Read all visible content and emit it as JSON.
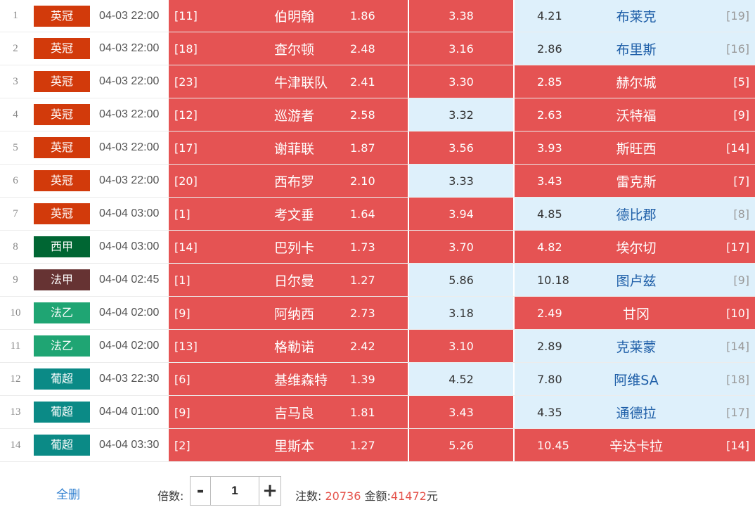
{
  "matches": [
    {
      "idx": "1",
      "league": "英冠",
      "league_color": "#d23a0b",
      "time": "04-03 22:00",
      "home_rank": "[11]",
      "home": "伯明翰",
      "home_odds": "1.86",
      "draw_odds": "3.38",
      "away_odds": "4.21",
      "away": "布莱克",
      "away_rank": "[19]",
      "home_sel": true,
      "draw_sel": true,
      "away_sel": false
    },
    {
      "idx": "2",
      "league": "英冠",
      "league_color": "#d23a0b",
      "time": "04-03 22:00",
      "home_rank": "[18]",
      "home": "查尔顿",
      "home_odds": "2.48",
      "draw_odds": "3.16",
      "away_odds": "2.86",
      "away": "布里斯",
      "away_rank": "[16]",
      "home_sel": true,
      "draw_sel": true,
      "away_sel": false
    },
    {
      "idx": "3",
      "league": "英冠",
      "league_color": "#d23a0b",
      "time": "04-03 22:00",
      "home_rank": "[23]",
      "home": "牛津联队",
      "home_odds": "2.41",
      "draw_odds": "3.30",
      "away_odds": "2.85",
      "away": "赫尔城",
      "away_rank": "[5]",
      "home_sel": true,
      "draw_sel": true,
      "away_sel": true
    },
    {
      "idx": "4",
      "league": "英冠",
      "league_color": "#d23a0b",
      "time": "04-03 22:00",
      "home_rank": "[12]",
      "home": "巡游者",
      "home_odds": "2.58",
      "draw_odds": "3.32",
      "away_odds": "2.63",
      "away": "沃特福",
      "away_rank": "[9]",
      "home_sel": true,
      "draw_sel": false,
      "away_sel": true
    },
    {
      "idx": "5",
      "league": "英冠",
      "league_color": "#d23a0b",
      "time": "04-03 22:00",
      "home_rank": "[17]",
      "home": "谢菲联",
      "home_odds": "1.87",
      "draw_odds": "3.56",
      "away_odds": "3.93",
      "away": "斯旺西",
      "away_rank": "[14]",
      "home_sel": true,
      "draw_sel": true,
      "away_sel": true
    },
    {
      "idx": "6",
      "league": "英冠",
      "league_color": "#d23a0b",
      "time": "04-03 22:00",
      "home_rank": "[20]",
      "home": "西布罗",
      "home_odds": "2.10",
      "draw_odds": "3.33",
      "away_odds": "3.43",
      "away": "雷克斯",
      "away_rank": "[7]",
      "home_sel": true,
      "draw_sel": false,
      "away_sel": true
    },
    {
      "idx": "7",
      "league": "英冠",
      "league_color": "#d23a0b",
      "time": "04-04 03:00",
      "home_rank": "[1]",
      "home": "考文垂",
      "home_odds": "1.64",
      "draw_odds": "3.94",
      "away_odds": "4.85",
      "away": "德比郡",
      "away_rank": "[8]",
      "home_sel": true,
      "draw_sel": true,
      "away_sel": false
    },
    {
      "idx": "8",
      "league": "西甲",
      "league_color": "#006633",
      "time": "04-04 03:00",
      "home_rank": "[14]",
      "home": "巴列卡",
      "home_odds": "1.73",
      "draw_odds": "3.70",
      "away_odds": "4.82",
      "away": "埃尔切",
      "away_rank": "[17]",
      "home_sel": true,
      "draw_sel": true,
      "away_sel": true
    },
    {
      "idx": "9",
      "league": "法甲",
      "league_color": "#663333",
      "time": "04-04 02:45",
      "home_rank": "[1]",
      "home": "日尔曼",
      "home_odds": "1.27",
      "draw_odds": "5.86",
      "away_odds": "10.18",
      "away": "图卢兹",
      "away_rank": "[9]",
      "home_sel": true,
      "draw_sel": false,
      "away_sel": false
    },
    {
      "idx": "10",
      "league": "法乙",
      "league_color": "#1fa573",
      "time": "04-04 02:00",
      "home_rank": "[9]",
      "home": "阿纳西",
      "home_odds": "2.73",
      "draw_odds": "3.18",
      "away_odds": "2.49",
      "away": "甘冈",
      "away_rank": "[10]",
      "home_sel": true,
      "draw_sel": false,
      "away_sel": true
    },
    {
      "idx": "11",
      "league": "法乙",
      "league_color": "#1fa573",
      "time": "04-04 02:00",
      "home_rank": "[13]",
      "home": "格勒诺",
      "home_odds": "2.42",
      "draw_odds": "3.10",
      "away_odds": "2.89",
      "away": "克莱蒙",
      "away_rank": "[14]",
      "home_sel": true,
      "draw_sel": true,
      "away_sel": false
    },
    {
      "idx": "12",
      "league": "葡超",
      "league_color": "#0b8a86",
      "time": "04-03 22:30",
      "home_rank": "[6]",
      "home": "基维森特",
      "home_odds": "1.39",
      "draw_odds": "4.52",
      "away_odds": "7.80",
      "away": "阿维SA",
      "away_rank": "[18]",
      "home_sel": true,
      "draw_sel": false,
      "away_sel": false
    },
    {
      "idx": "13",
      "league": "葡超",
      "league_color": "#0b8a86",
      "time": "04-04 01:00",
      "home_rank": "[9]",
      "home": "吉马良",
      "home_odds": "1.81",
      "draw_odds": "3.43",
      "away_odds": "4.35",
      "away": "通德拉",
      "away_rank": "[17]",
      "home_sel": true,
      "draw_sel": true,
      "away_sel": false
    },
    {
      "idx": "14",
      "league": "葡超",
      "league_color": "#0b8a86",
      "time": "04-04 03:30",
      "home_rank": "[2]",
      "home": "里斯本",
      "home_odds": "1.27",
      "draw_odds": "5.26",
      "away_odds": "10.45",
      "away": "辛达卡拉",
      "away_rank": "[14]",
      "home_sel": true,
      "draw_sel": true,
      "away_sel": true
    }
  ],
  "footer": {
    "clear_label": "全删",
    "multiplier_label": "倍数:",
    "minus_label": "-",
    "plus_label": "+",
    "multiplier_value": "1",
    "bets_label": "注数:",
    "bets_value": "20736",
    "amount_label": "金额:",
    "amount_value": "41472",
    "currency": "元"
  },
  "colors": {
    "selected_bg": "#e55353",
    "unselected_bg": "#def0fb",
    "accent_red": "#e5534b",
    "link_blue": "#2f7fd0"
  }
}
